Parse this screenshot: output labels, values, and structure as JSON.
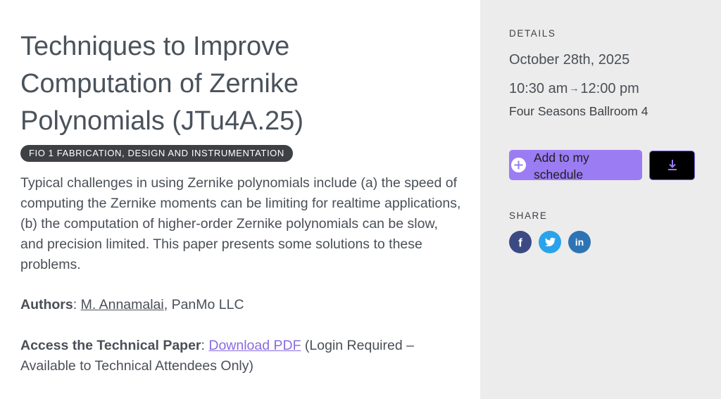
{
  "session": {
    "title_line1": "Techniques to Improve",
    "title_line2": "Computation of Zernike",
    "title_line3": "Polynomials (JTu4A.25)",
    "category": "FIO 1 FABRICATION, DESIGN AND INSTRUMENTATION",
    "abstract": "Typical challenges in using Zernike polynomials include (a) the speed of computing the Zernike moments can be limiting for realtime applications, (b) the computation of higher-order Zernike polynomials can be slow, and precision limited. This paper presents some solutions to these problems.",
    "authors_label": "Authors",
    "author_name": "M. Annamalai",
    "author_affiliation": ", PanMo LLC",
    "access_label": "Access the Technical Paper",
    "download_link": "Download PDF",
    "access_note": " (Login Required – Available to Technical Attendees Only)"
  },
  "details": {
    "heading": "DETAILS",
    "date": "October 28th, 2025",
    "start_time": "10:30 am",
    "arrow": "→",
    "end_time": "12:00 pm",
    "room": "Four Seasons Ballroom 4"
  },
  "actions": {
    "schedule_label": "Add to my schedule",
    "plus_icon": "plus-circle-icon",
    "download_icon": "download-icon",
    "accent_color": "#9b7cf3"
  },
  "share": {
    "heading": "SHARE",
    "facebook_glyph": "f",
    "linkedin_glyph": "in",
    "facebook_color": "#3b4a84",
    "twitter_color": "#29a3ec",
    "linkedin_color": "#2d74b4"
  }
}
